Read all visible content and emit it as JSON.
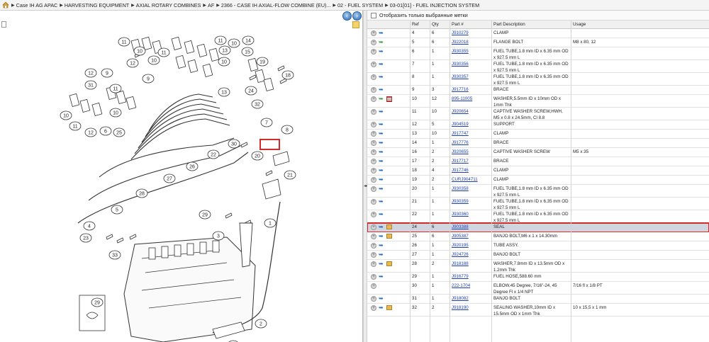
{
  "breadcrumb": [
    "Case IH AG APAC",
    "HARVESTING EQUIPMENT",
    "AXIAL ROTARY COMBINES",
    "AF",
    "2366 - CASE IH AXIAL-FLOW COMBINE (EU)...",
    "02 - FUEL SYSTEM",
    "03-01[01] - FUEL INJECTION SYSTEM"
  ],
  "filter": {
    "label": "Отобразить только выбранные метки"
  },
  "columns": {
    "ref": "Ref",
    "qty": "Qty",
    "part": "Part #",
    "desc": "Part Description",
    "usage": "Usage"
  },
  "colors": {
    "link": "#1d3fb5",
    "selected_row": "#cfd6df",
    "highlight": "#d42a2a"
  },
  "diagram_callouts": [
    "11",
    "10",
    "12",
    "10",
    "11",
    "9",
    "11",
    "10",
    "14",
    "13",
    "10",
    "15",
    "13",
    "19",
    "18",
    "9",
    "11",
    "10",
    "12",
    "10",
    "11",
    "12",
    "6",
    "25",
    "31",
    "24",
    "32",
    "30",
    "7",
    "8",
    "20",
    "21",
    "22",
    "26",
    "27",
    "28",
    "5",
    "4",
    "23",
    "33",
    "29",
    "3",
    "1",
    "29",
    "2",
    "32"
  ],
  "parts": [
    {
      "ref": "4",
      "qty": "6",
      "part": "J910279",
      "desc": "CLAMP",
      "usage": "",
      "icon": "blue"
    },
    {
      "ref": "5",
      "qty": "6",
      "part": "J922018",
      "desc": "FLANGE BOLT",
      "usage": "M8 x 80, 12",
      "icon": "green"
    },
    {
      "ref": "6",
      "qty": "1",
      "part": "J930355",
      "desc": "FUEL TUBE,1.8 mm ID x 6.35 mm OD x 927.5 mm L",
      "usage": "",
      "icon": "blue"
    },
    {
      "ref": "7",
      "qty": "1",
      "part": "J930356",
      "desc": "FUEL TUBE,1.8 mm ID x 6.35 mm OD x 927.5 mm L",
      "usage": "",
      "icon": "blue"
    },
    {
      "ref": "8",
      "qty": "1",
      "part": "J930357",
      "desc": "FUEL TUBE,1.8 mm ID x 6.35 mm OD x 927.5 mm L",
      "usage": "",
      "icon": "blue"
    },
    {
      "ref": "9",
      "qty": "3",
      "part": "J917716",
      "desc": "BRACE",
      "usage": "",
      "icon": "blue"
    },
    {
      "ref": "10",
      "qty": "12",
      "part": "895-11005",
      "desc": "WASHER,5.5mm ID x 10mm OD x 1mm Thk",
      "usage": "",
      "icon": "green-list"
    },
    {
      "ref": "11",
      "qty": "10",
      "part": "J920654",
      "desc": "CAPTIVE WASHER SCREW,HWH, M5 x 0.8 x 24.5mm, Cl 8.8",
      "usage": "",
      "icon": "blue"
    },
    {
      "ref": "12",
      "qty": "5",
      "part": "J904519",
      "desc": "SUPPORT",
      "usage": "",
      "icon": "blue"
    },
    {
      "ref": "13",
      "qty": "10",
      "part": "J917747",
      "desc": "CLAMP",
      "usage": "",
      "icon": "blue"
    },
    {
      "ref": "14",
      "qty": "1",
      "part": "J917776",
      "desc": "BRACE",
      "usage": "",
      "icon": "blue"
    },
    {
      "ref": "16",
      "qty": "2",
      "part": "J920655",
      "desc": "CAPTIVE WASHER SCREW",
      "usage": "M5 x 35",
      "icon": "blue"
    },
    {
      "ref": "17",
      "qty": "2",
      "part": "J917717",
      "desc": "BRACE",
      "usage": "",
      "icon": "blue"
    },
    {
      "ref": "18",
      "qty": "4",
      "part": "J917746",
      "desc": "CLAMP",
      "usage": "",
      "icon": "blue"
    },
    {
      "ref": "19",
      "qty": "2",
      "part": "CURJ904711",
      "desc": "CLAMP",
      "usage": "",
      "icon": "blue"
    },
    {
      "ref": "20",
      "qty": "1",
      "part": "J930358",
      "desc": "FUEL TUBE,1.8 mm ID x 6.35 mm OD x 927.5 mm L",
      "usage": "",
      "icon": "blue"
    },
    {
      "ref": "21",
      "qty": "1",
      "part": "J930359",
      "desc": "FUEL TUBE,1.8 mm ID x 6.35 mm OD x 927.5 mm L",
      "usage": "",
      "icon": "blue"
    },
    {
      "ref": "22",
      "qty": "1",
      "part": "J930360",
      "desc": "FUEL TUBE,1.8 mm ID x 6.35 mm OD x 927.5 mm L",
      "usage": "",
      "icon": "blue"
    },
    {
      "ref": "24",
      "qty": "6",
      "part": "J903388",
      "desc": "SEAL",
      "usage": "",
      "icon": "blue-box",
      "selected": true
    },
    {
      "ref": "25",
      "qty": "6",
      "part": "J905387",
      "desc": "BANJO BOLT,M6 x 1 x 14.30mm",
      "usage": "",
      "icon": "blue-box"
    },
    {
      "ref": "26",
      "qty": "1",
      "part": "J920195",
      "desc": "TUBE ASSY.",
      "usage": "",
      "icon": "blue"
    },
    {
      "ref": "27",
      "qty": "1",
      "part": "J924726",
      "desc": "BANJO BOLT",
      "usage": "",
      "icon": "blue"
    },
    {
      "ref": "28",
      "qty": "2",
      "part": "J918188",
      "desc": "WASHER,7.8mm ID x 13.5mm OD x 1.2mm Thk",
      "usage": "",
      "icon": "blue-box"
    },
    {
      "ref": "29",
      "qty": "1",
      "part": "J916779",
      "desc": "FUEL HOSE,588.60 mm",
      "usage": "",
      "icon": "blue"
    },
    {
      "ref": "30",
      "qty": "1",
      "part": "222-1704",
      "desc": "ELBOW,45 Degree, 7/16\"-24, 45 Degree Fl x 1/4 NPT",
      "usage": "7/16 fl x 1/8 PT",
      "icon": "none"
    },
    {
      "ref": "31",
      "qty": "1",
      "part": "J918082",
      "desc": "BANJO BOLT",
      "usage": "",
      "icon": "blue"
    },
    {
      "ref": "32",
      "qty": "2",
      "part": "J918190",
      "desc": "SEALING WASHER,10mm ID x 15.5mm OD x 1mm Thk",
      "usage": "10 x 15,5 x 1 mm",
      "icon": "blue-box"
    }
  ]
}
